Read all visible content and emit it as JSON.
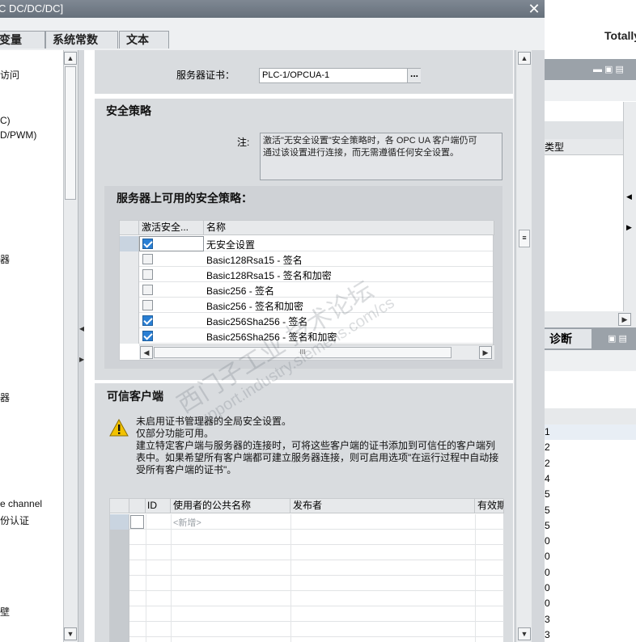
{
  "dialog": {
    "title": "C DC/DC/DC]",
    "close_glyph": "✕",
    "tabs": [
      "变量",
      "系统常数",
      "文本"
    ]
  },
  "left_nav": {
    "items": [
      "访问",
      "C)",
      "D/PWM)",
      "器",
      "器",
      "e channel",
      "份认证",
      "壁"
    ]
  },
  "server_cert": {
    "label": "服务器证书：",
    "value": "PLC-1/OPCUA-1",
    "browse": "..."
  },
  "security_policy": {
    "title": "安全策略",
    "note_label": "注:",
    "note_text_1": "激活\"无安全设置\"安全策略时，各 OPC UA 客户端仍可",
    "note_text_2": "通过该设置进行连接，而无需遵循任何安全设置。",
    "available_title": "服务器上可用的安全策略：",
    "col_active": "激活安全...",
    "col_name": "名称",
    "policies": [
      {
        "name": "无安全设置",
        "active": true
      },
      {
        "name": "Basic128Rsa15 - 签名",
        "active": false
      },
      {
        "name": "Basic128Rsa15 - 签名和加密",
        "active": false
      },
      {
        "name": "Basic256 - 签名",
        "active": false
      },
      {
        "name": "Basic256 - 签名和加密",
        "active": false
      },
      {
        "name": "Basic256Sha256 - 签名",
        "active": true
      },
      {
        "name": "Basic256Sha256 - 签名和加密",
        "active": true
      }
    ],
    "hscroll_mid": "III"
  },
  "trusted_clients": {
    "title": "可信客户端",
    "warn_1": "未启用证书管理器的全局安全设置。",
    "warn_2": "仅部分功能可用。",
    "warn_3": "建立特定客户端与服务器的连接时，可将这些客户端的证书添加到可信任的客户端列",
    "warn_4": "表中。如果希望所有客户端都可建立服务器连接，则可启用选项\"在运行过程中自动接",
    "warn_5": "受所有客户端的证书\"。",
    "col_id": "ID",
    "col_name": "使用者的公共名称",
    "col_issuer": "发布者",
    "col_valid": "有效期",
    "new_row": "<新增>"
  },
  "right_app": {
    "title": "Totally",
    "col_type": "类型",
    "diag_tab": "诊断",
    "values": [
      "1",
      "2",
      "2",
      "4",
      "5",
      "5",
      "5",
      "0",
      "0",
      "0",
      "0",
      "0",
      "3",
      "3"
    ]
  },
  "watermark": {
    "line1": "西门子工业  技术论坛",
    "line2": "support.industry.siemens.com/cs"
  },
  "colors": {
    "checkbox_on": "#2a7fd4",
    "warning": "#f2c200"
  }
}
